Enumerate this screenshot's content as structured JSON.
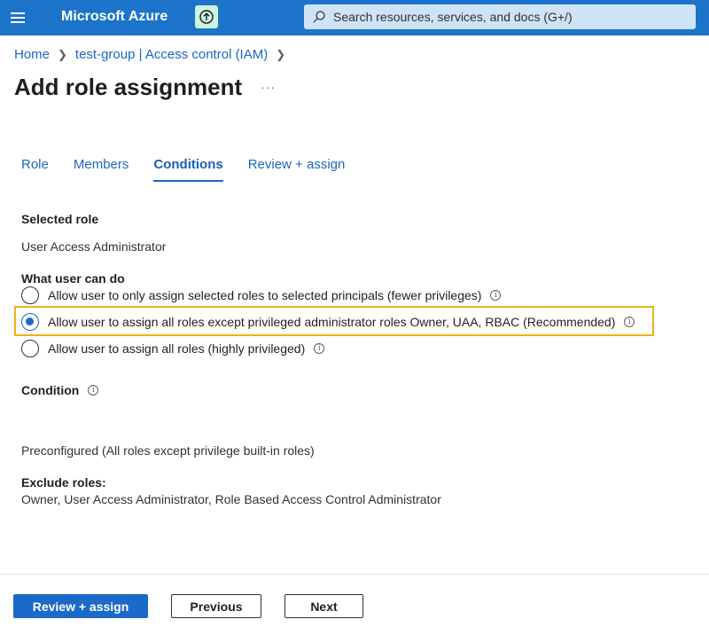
{
  "topbar": {
    "brand": "Microsoft Azure",
    "search_placeholder": "Search resources, services, and docs (G+/)"
  },
  "breadcrumb": {
    "items": [
      "Home",
      "test-group | Access control (IAM)"
    ]
  },
  "page": {
    "title": "Add role assignment",
    "more": "···"
  },
  "tabs": [
    {
      "label": "Role",
      "active": false
    },
    {
      "label": "Members",
      "active": false
    },
    {
      "label": "Conditions",
      "active": true
    },
    {
      "label": "Review + assign",
      "active": false
    }
  ],
  "selected_role": {
    "heading": "Selected role",
    "value": "User Access Administrator"
  },
  "what_user_can_do": {
    "heading": "What user can do",
    "options": [
      {
        "label": "Allow user to only assign selected roles to selected principals (fewer privileges)",
        "checked": false
      },
      {
        "label": "Allow user to assign all roles except privileged administrator roles Owner, UAA, RBAC (Recommended)",
        "checked": true
      },
      {
        "label": "Allow user to assign all roles (highly privileged)",
        "checked": false
      }
    ]
  },
  "condition": {
    "heading": "Condition",
    "value": "Preconfigured (All roles except privilege built-in roles)"
  },
  "exclude_roles": {
    "heading": "Exclude roles:",
    "value": "Owner, User Access Administrator, Role Based Access Control Administrator"
  },
  "footer": {
    "review_assign": "Review + assign",
    "previous": "Previous",
    "next": "Next"
  },
  "colors": {
    "topbar": "#1b74c9",
    "accent": "#1b6ac9",
    "highlight": "#f2b01e",
    "upgrade_bg": "#cdf4df"
  }
}
